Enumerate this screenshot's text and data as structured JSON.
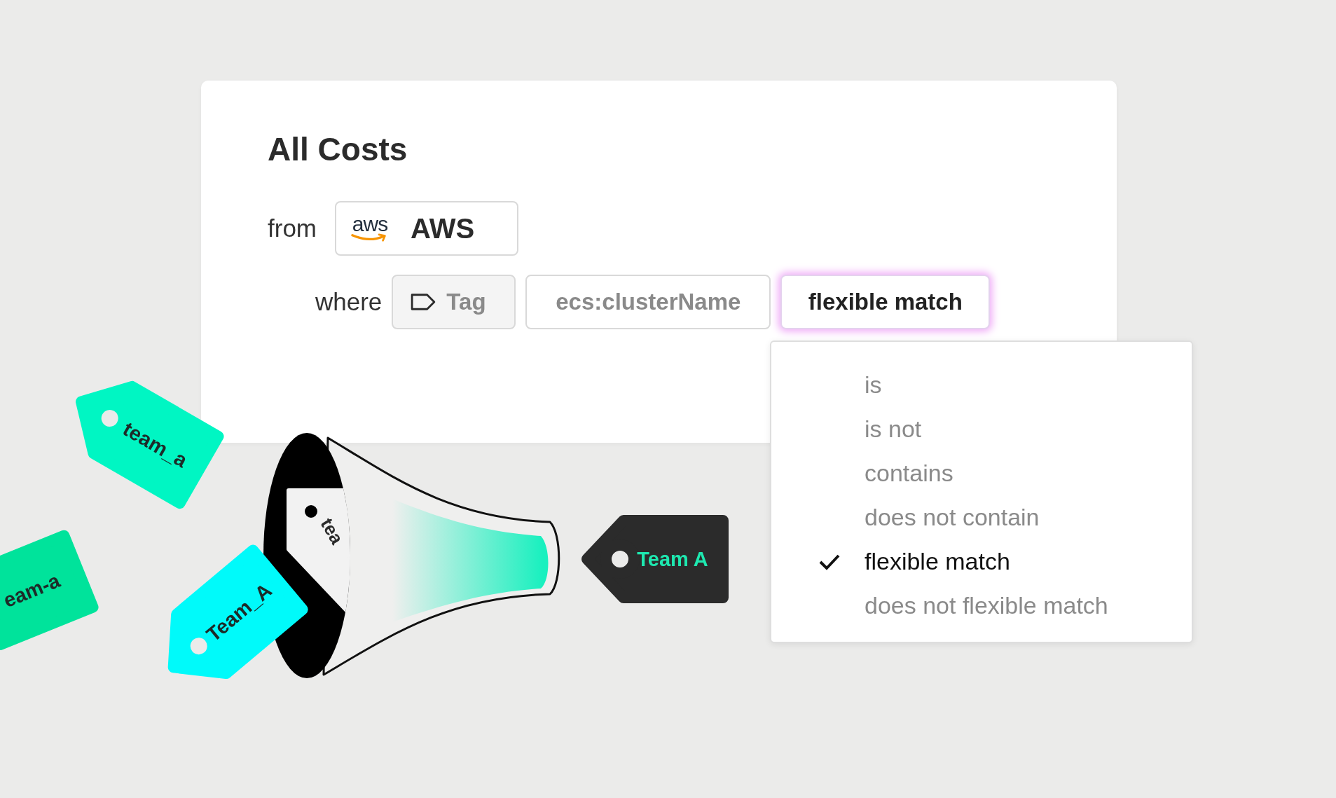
{
  "card": {
    "title": "All Costs",
    "from_label": "from",
    "source": {
      "logo_text": "aws",
      "label": "AWS"
    },
    "where_label": "where",
    "filters": [
      {
        "kind": "dimension",
        "label": "Tag",
        "focused": false
      },
      {
        "kind": "key",
        "label": "ecs:clusterName",
        "focused": false
      },
      {
        "kind": "operator",
        "label": "flexible match",
        "focused": true
      }
    ]
  },
  "dropdown": {
    "options": [
      {
        "label": "is",
        "selected": false
      },
      {
        "label": "is not",
        "selected": false
      },
      {
        "label": "contains",
        "selected": false
      },
      {
        "label": "does not contain",
        "selected": false
      },
      {
        "label": "flexible match",
        "selected": true
      },
      {
        "label": "does not flexible match",
        "selected": false
      }
    ]
  },
  "illustration": {
    "tags": [
      {
        "label": "team_a",
        "color": "#00f6c3"
      },
      {
        "label": "eam-a",
        "color": "#00e39b"
      },
      {
        "label": "Team_A",
        "color": "#00fafa"
      }
    ],
    "megaphone": {
      "inner_tag": "tea"
    },
    "output_tag": {
      "label": "Team A",
      "color": "#2b2b2b"
    }
  }
}
